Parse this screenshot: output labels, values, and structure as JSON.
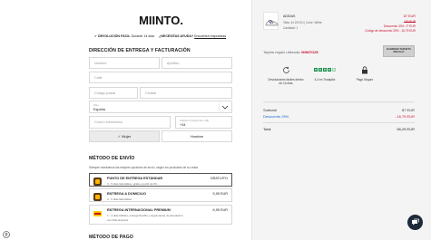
{
  "brand": {
    "logo": "MIINTO."
  },
  "notice": {
    "part1": "✓ DEVOLUCIÓN FÁCIL",
    "part2": "Durante 14 días",
    "part3": "¿NECESITAS AYUDA?",
    "part4": "Encuentra respuestas"
  },
  "address": {
    "title": "DIRECCIÓN DE ENTREGA Y FACTURACIÓN",
    "first_name": "Nombre",
    "last_name": "Apellido",
    "street": "Calle",
    "postal_code": "Código postal",
    "city": "Ciudad",
    "country_label": "País",
    "country_value": "España",
    "email": "Correo electrónico",
    "phone_label": "Teléfono (incluyendo +34)",
    "phone_value": "+34",
    "gender_female": "✓  Mujer",
    "gender_male": "Hombre"
  },
  "shipping": {
    "title": "MÉTODO DE ENVÍO",
    "note": "Siempre mostramos las mejores opciones de envío, según los productos de su cesta",
    "options": [
      {
        "title": "PUNTO DE ENTREGA ESTÁNDAR",
        "desc": [
          "3 - 5 días laborables, gratis a partir de 50..."
        ],
        "price": "GRATUITO"
      },
      {
        "title": "ENTREGA A DOMICILIO",
        "desc": [
          "3 - 5 días laborables"
        ],
        "price": "5,95 EUR"
      },
      {
        "title": "ENTREGA INTERNACIONAL PREMIUM",
        "desc": [
          "1 - 4 días hábiles, entrega flexible y seguimiento de devolución",
          "con DHL Express"
        ],
        "price": "6,95 EUR"
      }
    ]
  },
  "payment": {
    "title": "MÉTODO DE PAGO"
  },
  "product": {
    "name": "ADIDAS",
    "details": "Talla: 44 2/3 EU  |  Color: White",
    "qty": "Cantidad: 1",
    "price": "87 EUR",
    "old_price": "130 EUR",
    "discount1": "Descuento 33% - P EUR",
    "discount2": "Código de descuento 25% - 16,75 EUR"
  },
  "gift": {
    "label": "Tarjeta regalo utilizada:",
    "code": "MIINTO25",
    "button": "ELIMINAR TARJETA REGALO"
  },
  "usps": [
    {
      "text": "Devoluciones fáciles dentro de 14 días"
    },
    {
      "text": "4,3 en Trustpilot"
    },
    {
      "text": "Pago Seguro"
    }
  ],
  "summary": {
    "subtotal_label": "Subtotal",
    "subtotal_value": "87 EUR",
    "discount_label": "Descuento 25%",
    "discount_value": "- 16,75 EUR",
    "total_label": "Total",
    "total_value": "56,25 EUR"
  },
  "colors": {
    "accent_red": "#c8102e",
    "trustpilot": "#1a8f4a",
    "ups": "#5a3a1a",
    "dhl": "#ffcc00"
  }
}
